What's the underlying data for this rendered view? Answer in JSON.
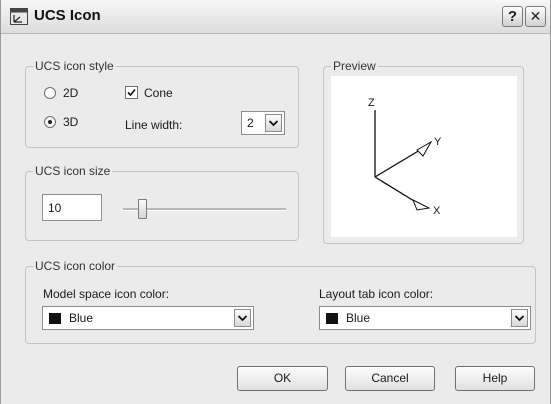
{
  "window": {
    "title": "UCS Icon"
  },
  "titlebar": {
    "help_glyph": "?",
    "close_glyph": "✕"
  },
  "style_group": {
    "label": "UCS icon style",
    "radio_2d": "2D",
    "radio_3d": "3D",
    "selected": "3D",
    "cone_label": "Cone",
    "cone_checked": true,
    "line_width_label": "Line width:",
    "line_width_value": "2"
  },
  "preview_group": {
    "label": "Preview",
    "axes": {
      "z": "Z",
      "y": "Y",
      "x": "X"
    }
  },
  "size_group": {
    "label": "UCS icon size",
    "value": "10",
    "slider_fraction": 0.1
  },
  "color_group": {
    "label": "UCS icon color",
    "model_label": "Model space icon color:",
    "model_value": "Blue",
    "layout_label": "Layout tab icon color:",
    "layout_value": "Blue"
  },
  "buttons": {
    "ok": "OK",
    "cancel": "Cancel",
    "help": "Help"
  },
  "colors": {
    "swatch": "#111111",
    "dialog_bg": "#ebebeb"
  }
}
